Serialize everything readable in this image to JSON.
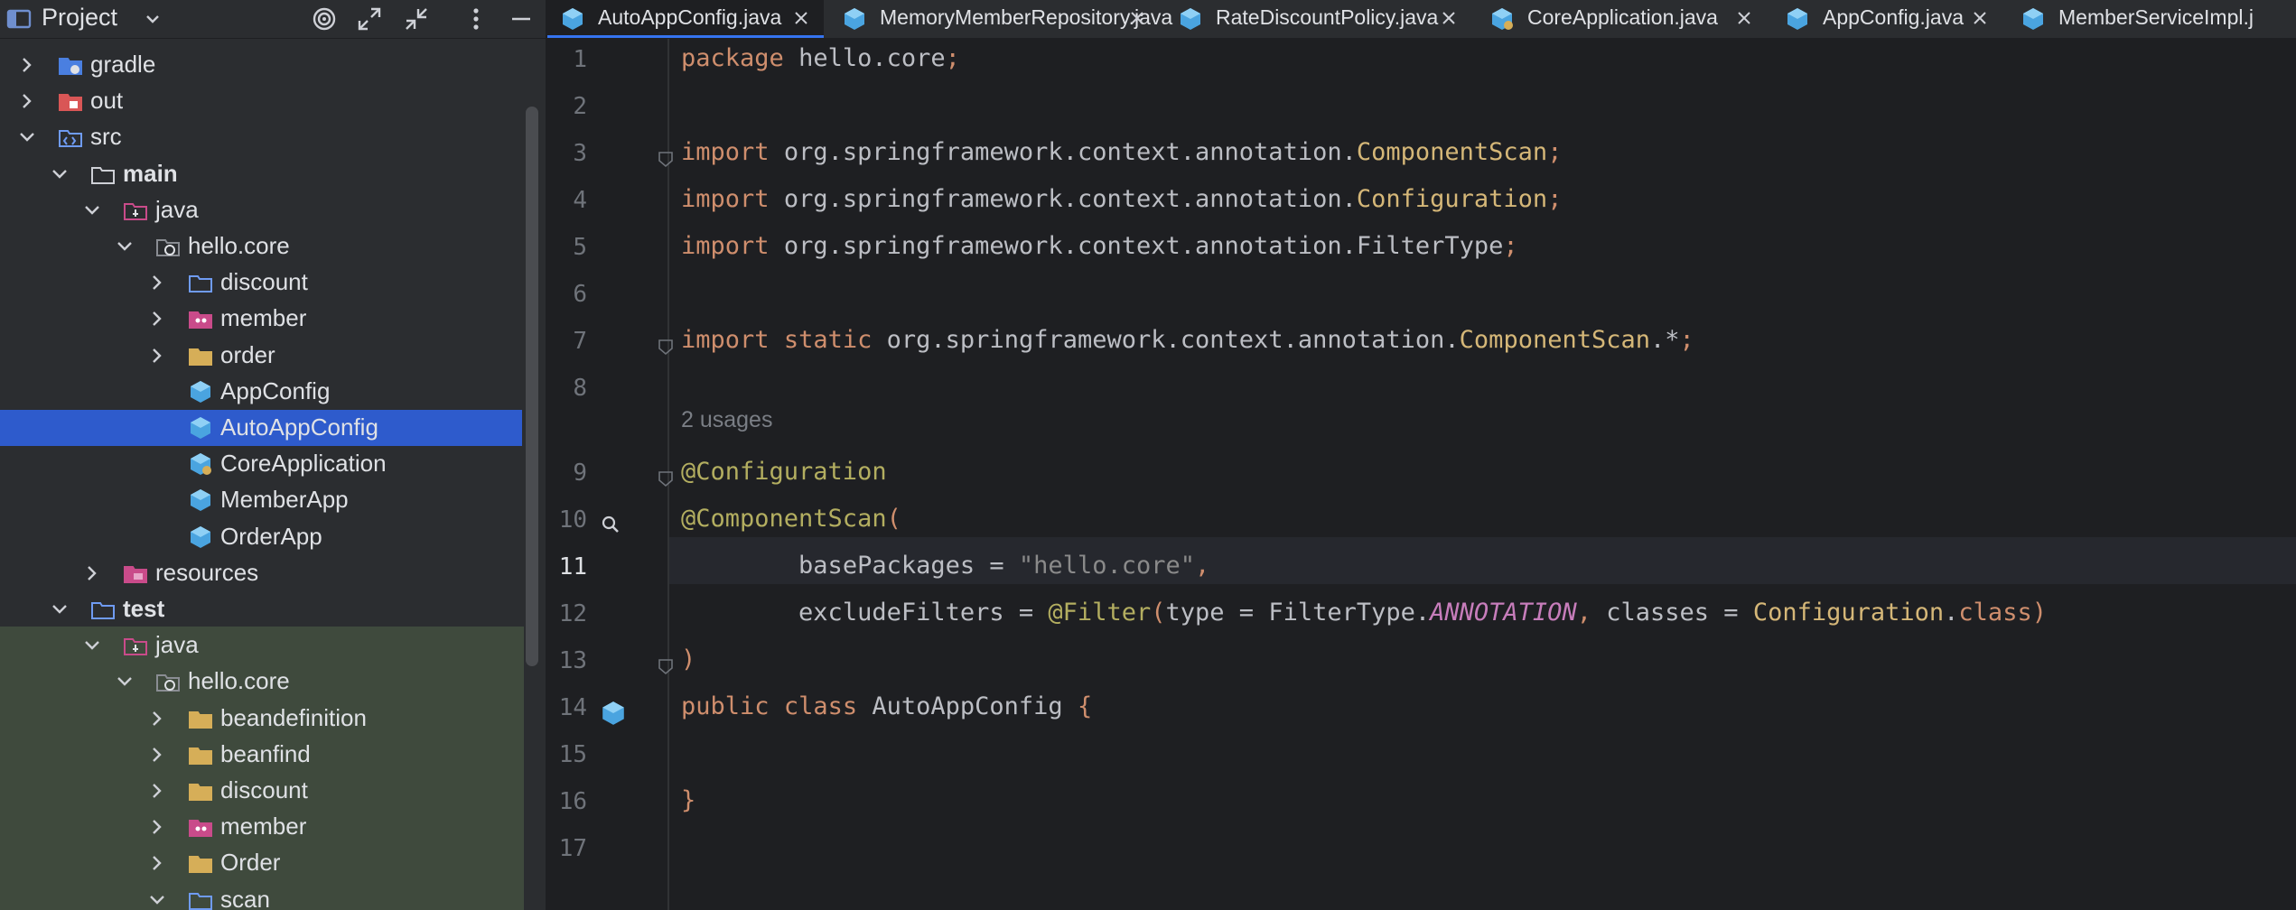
{
  "project_panel": {
    "title": "Project",
    "tree": [
      {
        "label": "gradle",
        "icon": "folder-gradle-icon",
        "expanded": false
      },
      {
        "label": "out",
        "icon": "folder-excluded-icon",
        "expanded": false
      },
      {
        "label": "src",
        "icon": "folder-source-icon",
        "expanded": true
      },
      {
        "label": "main",
        "icon": "folder-icon",
        "expanded": true
      },
      {
        "label": "java",
        "icon": "source-root-icon",
        "expanded": true
      },
      {
        "label": "hello.core",
        "icon": "package-icon",
        "expanded": true
      },
      {
        "label": "discount",
        "icon": "package-folder-icon",
        "expanded": false
      },
      {
        "label": "member",
        "icon": "member-folder-icon",
        "expanded": false
      },
      {
        "label": "order",
        "icon": "yellow-folder-icon",
        "expanded": false
      },
      {
        "label": "AppConfig",
        "icon": "class-icon"
      },
      {
        "label": "AutoAppConfig",
        "icon": "class-icon",
        "selected": true
      },
      {
        "label": "CoreApplication",
        "icon": "spring-boot-class-icon"
      },
      {
        "label": "MemberApp",
        "icon": "class-icon"
      },
      {
        "label": "OrderApp",
        "icon": "class-icon"
      },
      {
        "label": "resources",
        "icon": "resources-folder-icon",
        "expanded": false
      },
      {
        "label": "test",
        "icon": "test-folder-icon",
        "expanded": true
      },
      {
        "label": "java",
        "icon": "test-source-root-icon",
        "expanded": true
      },
      {
        "label": "hello.core",
        "icon": "package-icon",
        "expanded": true
      },
      {
        "label": "beandefinition",
        "icon": "yellow-folder-icon",
        "expanded": false
      },
      {
        "label": "beanfind",
        "icon": "yellow-folder-icon",
        "expanded": false
      },
      {
        "label": "discount",
        "icon": "yellow-folder-icon",
        "expanded": false
      },
      {
        "label": "member",
        "icon": "member-folder-icon",
        "expanded": false
      },
      {
        "label": "Order",
        "icon": "yellow-folder-icon",
        "expanded": false
      },
      {
        "label": "scan",
        "icon": "package-folder-icon",
        "expanded": true
      }
    ]
  },
  "tabs": [
    {
      "label": "AutoAppConfig.java",
      "active": true
    },
    {
      "label": "MemoryMemberRepository.java"
    },
    {
      "label": "RateDiscountPolicy.java"
    },
    {
      "label": "CoreApplication.java"
    },
    {
      "label": "AppConfig.java"
    },
    {
      "label": "MemberServiceImpl.j"
    }
  ],
  "editor": {
    "current_line": 11,
    "usages_hint": "2 usages",
    "lines": [
      {
        "n": "1",
        "text": "package hello.core;"
      },
      {
        "n": "2",
        "text": ""
      },
      {
        "n": "3",
        "text": "import org.springframework.context.annotation.ComponentScan;"
      },
      {
        "n": "4",
        "text": "import org.springframework.context.annotation.Configuration;"
      },
      {
        "n": "5",
        "text": "import org.springframework.context.annotation.FilterType;"
      },
      {
        "n": "6",
        "text": ""
      },
      {
        "n": "7",
        "text": "import static org.springframework.context.annotation.ComponentScan.*;"
      },
      {
        "n": "8",
        "text": ""
      },
      {
        "n": "9",
        "text": "@Configuration"
      },
      {
        "n": "10",
        "text": "@ComponentScan("
      },
      {
        "n": "11",
        "text": "        basePackages = \"hello.core\","
      },
      {
        "n": "12",
        "text": "        excludeFilters = @Filter(type = FilterType.ANNOTATION, classes = Configuration.class)"
      },
      {
        "n": "13",
        "text": ")"
      },
      {
        "n": "14",
        "text": "public class AutoAppConfig {"
      },
      {
        "n": "15",
        "text": ""
      },
      {
        "n": "16",
        "text": "}"
      },
      {
        "n": "17",
        "text": ""
      }
    ]
  },
  "colors": {
    "panel_bg": "#2b2d30",
    "editor_bg": "#1e1f22",
    "selection": "#2e5bcc",
    "test_bg": "#3f4a3d",
    "keyword": "#cf8e6d",
    "annotation": "#b3ae60",
    "string": "#6aab73"
  }
}
